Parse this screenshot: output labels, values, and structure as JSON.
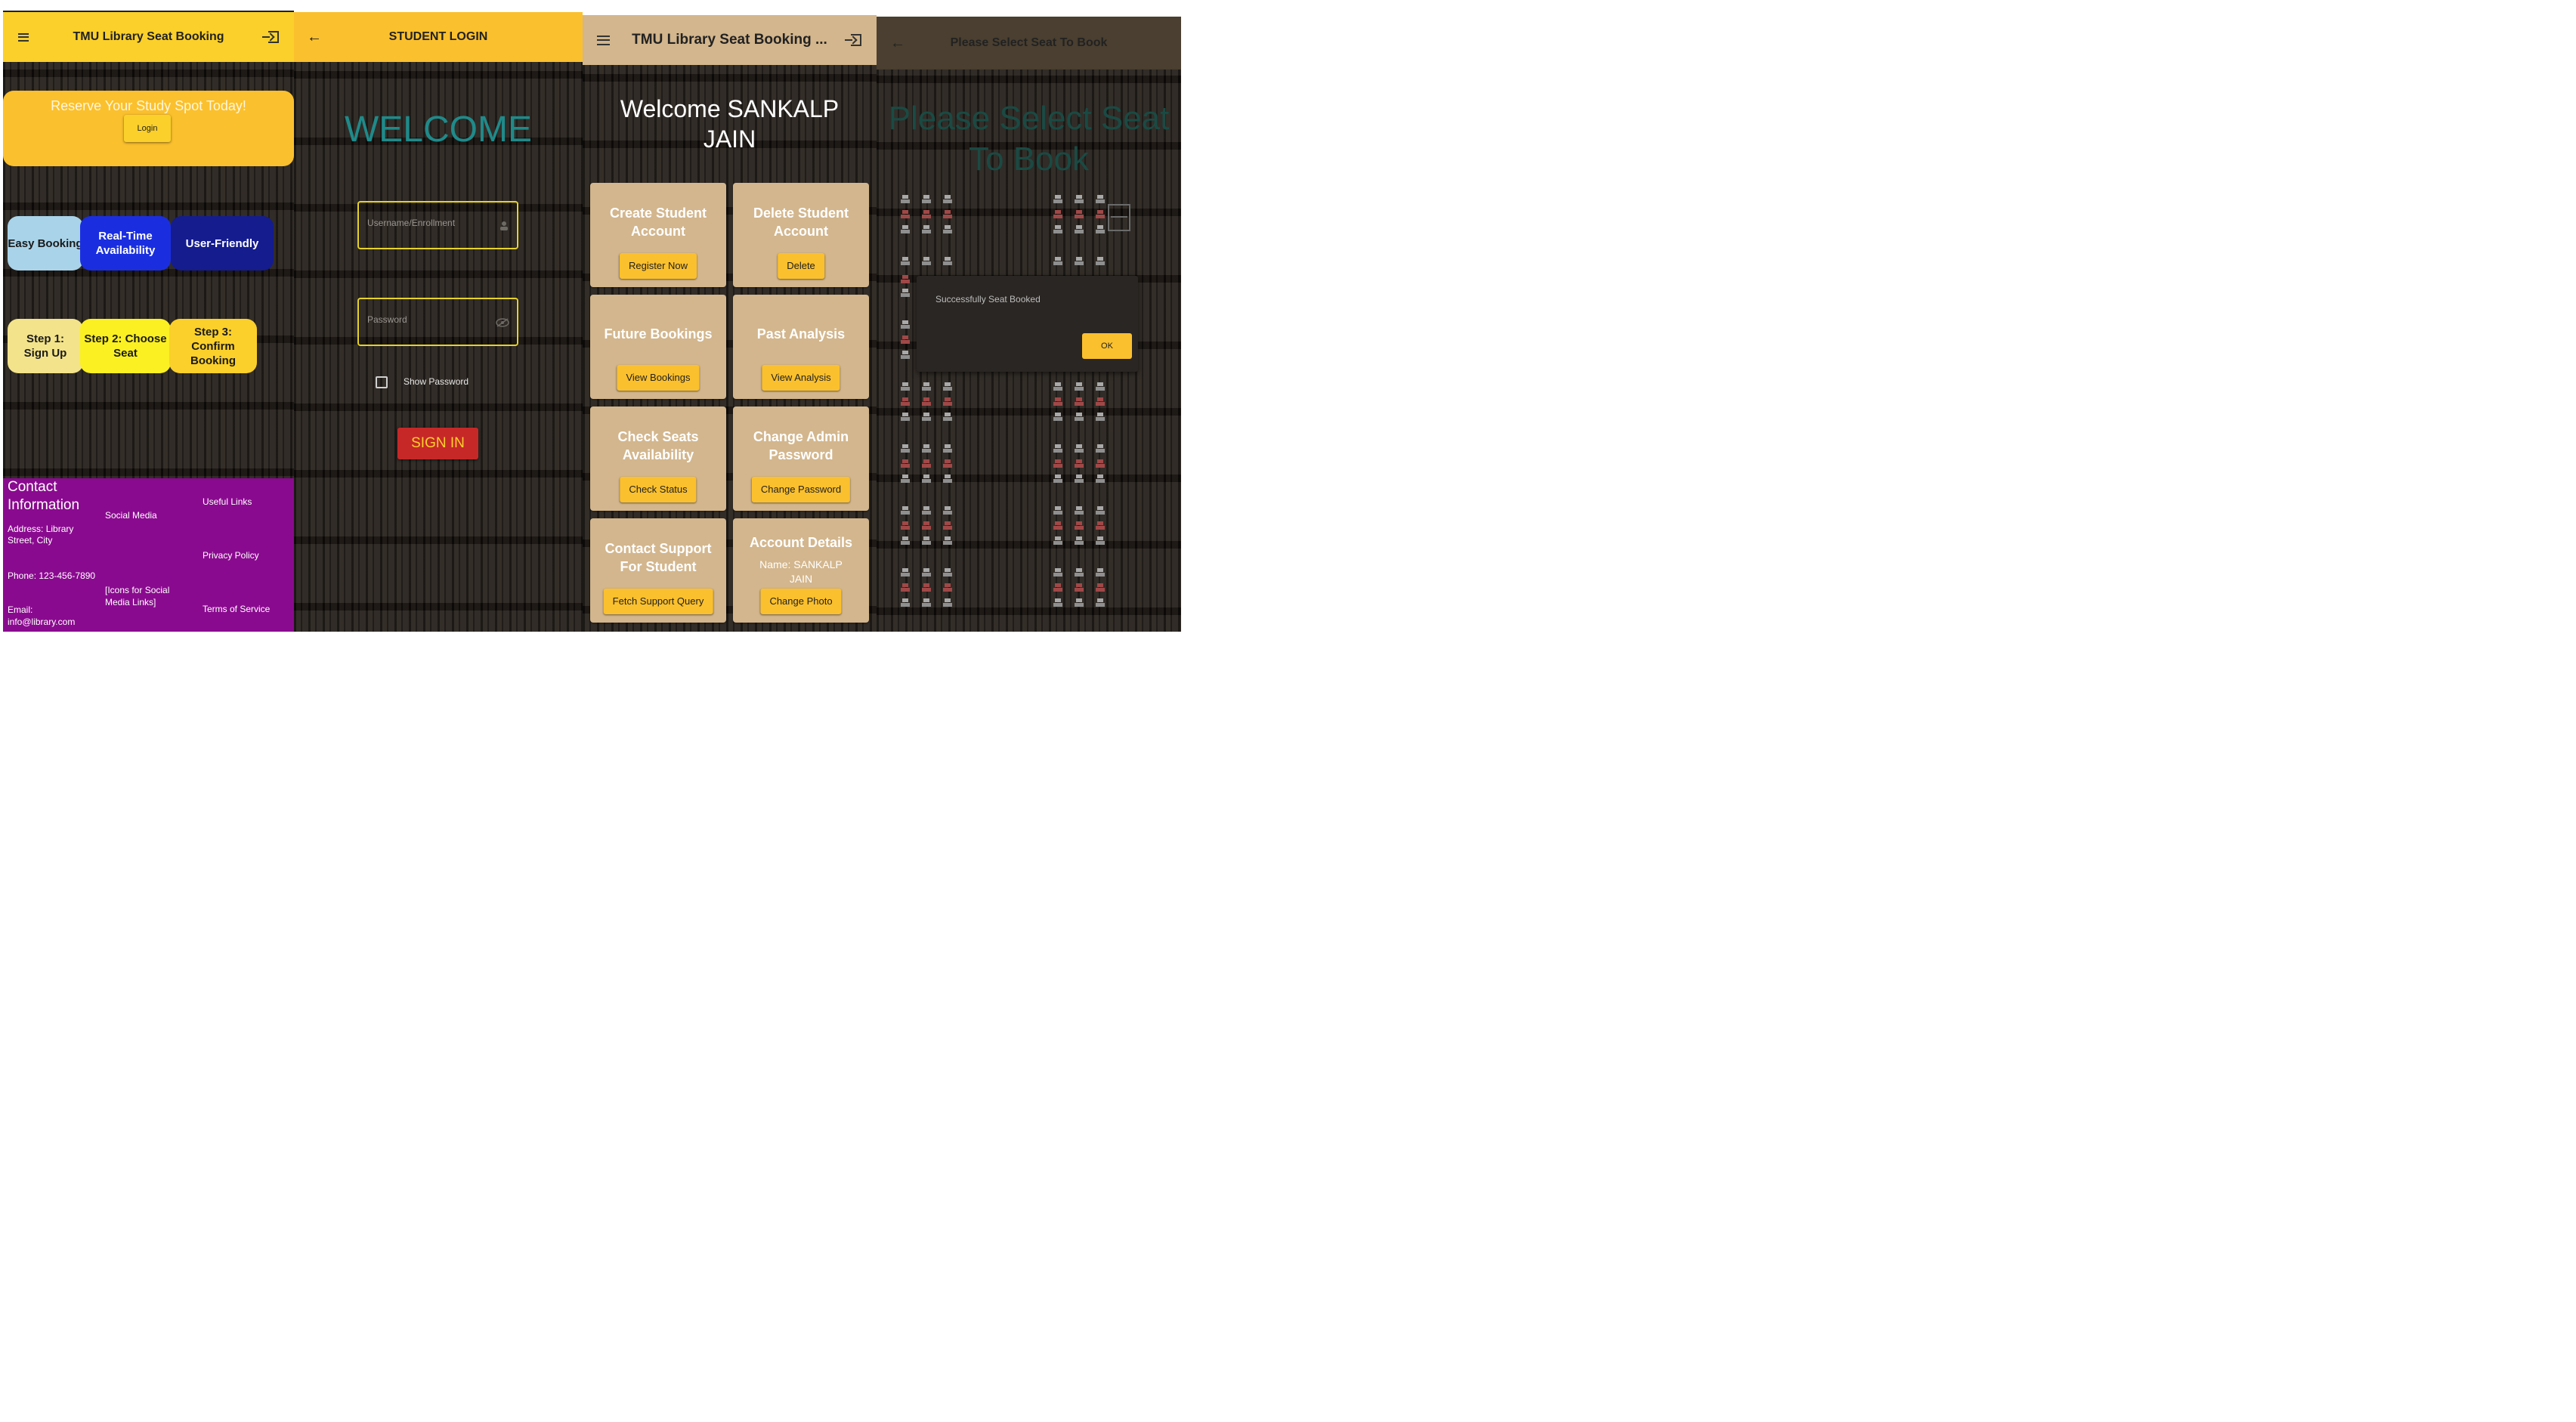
{
  "home": {
    "app_title": "TMU Library Seat Booking",
    "hero_text": "Reserve Your Study Spot Today!",
    "login_label": "Login",
    "features": [
      "Easy Booking",
      "Real-Time Availability",
      "User-Friendly"
    ],
    "steps": [
      "Step 1: Sign Up",
      "Step 2: Choose Seat",
      "Step 3: Confirm Booking"
    ],
    "footer": {
      "contact_heading": "Contact Information",
      "address": "Address: Library Street, City",
      "phone": "Phone: 123-456-7890",
      "email": "Email: info@library.com",
      "social_heading": "Social Media",
      "social_icons": "[Icons for Social Media Links]",
      "useful_links": "Useful Links",
      "privacy": "Privacy Policy",
      "terms": "Terms of Service"
    },
    "colors": {
      "appbar": "#fbd02a",
      "hero": "#fbc02d",
      "footer": "#8a0a8f"
    }
  },
  "login": {
    "title": "STUDENT LOGIN",
    "welcome": "WELCOME",
    "username_placeholder": "Username/Enrollment",
    "password_placeholder": "Password",
    "show_password": "Show Password",
    "sign_in": "SIGN IN",
    "colors": {
      "appbar": "#fbc02d",
      "welcome": "#1f8a8a",
      "sign_in": "#c62828"
    }
  },
  "dashboard": {
    "app_title": "TMU Library Seat Booking ...",
    "welcome": "Welcome SANKALP JAIN",
    "cards": [
      {
        "title": "Create Student Account",
        "button": "Register Now"
      },
      {
        "title": "Delete Student Account",
        "button": "Delete"
      },
      {
        "title": "Future Bookings",
        "button": "View Bookings"
      },
      {
        "title": "Past Analysis",
        "button": "View Analysis"
      },
      {
        "title": "Check Seats Availability",
        "button": "Check Status"
      },
      {
        "title": "Change Admin Password",
        "button": "Change Password"
      },
      {
        "title": "Contact Support For Student",
        "button": "Fetch Support Query"
      },
      {
        "title": "Account Details",
        "subtitle": "Name: SANKALP JAIN",
        "button": "Change Photo"
      }
    ],
    "colors": {
      "card": "#d3b68d",
      "button": "#fbc02d"
    }
  },
  "seats": {
    "title": "Please Select Seat To Book",
    "heading": "Please Select Seat To Book",
    "dialog_message": "Successfully Seat Booked",
    "ok_label": "OK"
  }
}
